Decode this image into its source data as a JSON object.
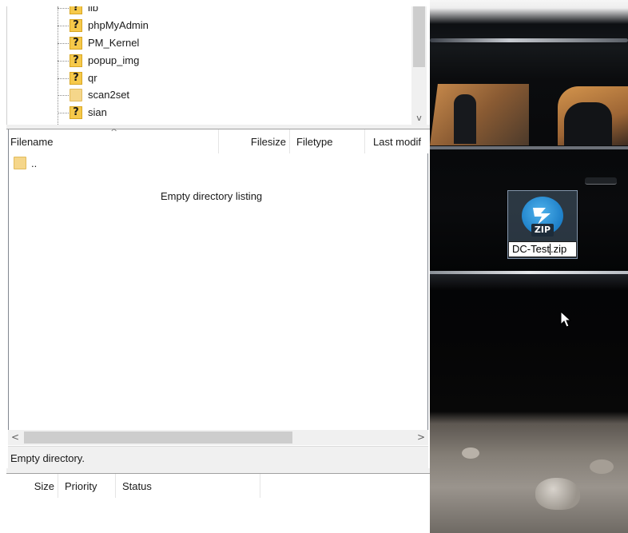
{
  "tree": {
    "items": [
      {
        "label": "lib",
        "icon": "question-folder-icon"
      },
      {
        "label": "phpMyAdmin",
        "icon": "question-folder-icon"
      },
      {
        "label": "PM_Kernel",
        "icon": "question-folder-icon"
      },
      {
        "label": "popup_img",
        "icon": "question-folder-icon"
      },
      {
        "label": "qr",
        "icon": "question-folder-icon"
      },
      {
        "label": "scan2set",
        "icon": "folder-icon"
      },
      {
        "label": "sian",
        "icon": "question-folder-icon"
      }
    ],
    "unknown_glyph": "?"
  },
  "filelist": {
    "columns": {
      "filename": "Filename",
      "filesize": "Filesize",
      "filetype": "Filetype",
      "last_modified": "Last modif"
    },
    "sort_indicator": "^",
    "parent_entry": "..",
    "empty_message": "Empty directory listing"
  },
  "scrollbars": {
    "left_arrow": "<",
    "right_arrow": ">",
    "down_arrow": "v"
  },
  "status": {
    "text": "Empty directory."
  },
  "queue": {
    "columns": {
      "size": "Size",
      "priority": "Priority",
      "status": "Status"
    }
  },
  "desktop_icon": {
    "badge": "ZIP",
    "name_before_caret": "DC-Test",
    "name_after_caret": ".zip",
    "circle_color": "#1d7fc8"
  },
  "colors": {
    "selection": "#6e8caa",
    "question_folder": "#f6c94a",
    "folder": "#f5d68a"
  }
}
